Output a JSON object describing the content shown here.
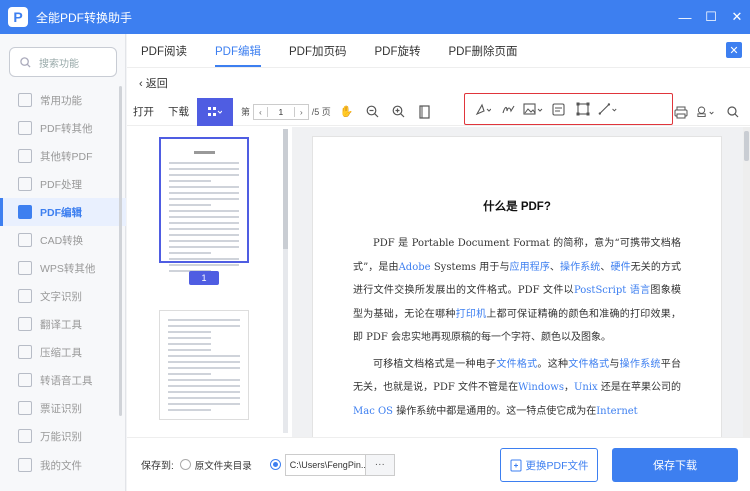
{
  "app": {
    "title": "全能PDF转换助手",
    "logo": "P"
  },
  "window": {
    "minimize": "—",
    "maximize": "☐",
    "close": "✕"
  },
  "sidebar": {
    "search_placeholder": "搜索功能",
    "items": [
      {
        "label": "常用功能",
        "active": false
      },
      {
        "label": "PDF转其他",
        "active": false
      },
      {
        "label": "其他转PDF",
        "active": false
      },
      {
        "label": "PDF处理",
        "active": false
      },
      {
        "label": "PDF编辑",
        "active": true
      },
      {
        "label": "CAD转换",
        "active": false
      },
      {
        "label": "WPS转其他",
        "active": false
      },
      {
        "label": "文字识别",
        "active": false
      },
      {
        "label": "翻译工具",
        "active": false
      },
      {
        "label": "压缩工具",
        "active": false
      },
      {
        "label": "转语音工具",
        "active": false
      },
      {
        "label": "票证识别",
        "active": false
      },
      {
        "label": "万能识别",
        "active": false
      }
    ],
    "bottom_item": "我的文件"
  },
  "tabs": [
    "PDF阅读",
    "PDF编辑",
    "PDF加页码",
    "PDF旋转",
    "PDF删除页面"
  ],
  "active_tab": 1,
  "back_label": "返回",
  "toolbar": {
    "open": "打开",
    "download": "下载",
    "page_prefix": "第",
    "prev": "‹",
    "page_current": "1",
    "next": "›",
    "page_total": "/5 页"
  },
  "thumbnail": {
    "page_badge": "1"
  },
  "document": {
    "title": "什么是 PDF?",
    "p1_a": "PDF 是 Portable Document Format 的简称，意为“可携带文档格式”，是由",
    "p1_link1": "Adobe",
    "p1_b": " Systems 用于与",
    "p1_link2": "应用程序",
    "p1_c": "、",
    "p1_link3": "操作系统",
    "p1_d": "、",
    "p1_link4": "硬件",
    "p1_e": "无关的方式进行文件交换所发展出的文件格式。PDF 文件以",
    "p1_link5": "PostScript 语言",
    "p1_f": "图象模型为基础，无论在哪种",
    "p1_link6": "打印机",
    "p1_g": "上都可保证精确的颜色和准确的打印效果，即 PDF 会忠实地再现原稿的每一个字符、颜色以及图象。",
    "p2_a": "可移植文档格式是一种电子",
    "p2_link1": "文件格式",
    "p2_b": "。这种",
    "p2_link2": "文件格式",
    "p2_c": "与",
    "p2_link3": "操作系统",
    "p2_d": "平台无关，也就是说，PDF 文件不管是在",
    "p2_link4": "Windows",
    "p2_e": "，",
    "p2_link5": "Unix",
    "p2_f": " 还是在苹果公司的",
    "p2_link6": "Mac OS",
    "p2_g": " 操作系统中都是通用的。这一特点使它成为在",
    "p2_link7": "Internet"
  },
  "footer": {
    "save_to": "保存到:",
    "option_source": "原文件夹目录",
    "path": "C:\\Users\\FengPin...",
    "browse": "···",
    "change_button": "更换PDF文件",
    "save_button": "保存下载"
  },
  "colors": {
    "accent": "#3d7ff0",
    "view_active": "#4f5de2",
    "highlight_border": "#e0353b"
  }
}
